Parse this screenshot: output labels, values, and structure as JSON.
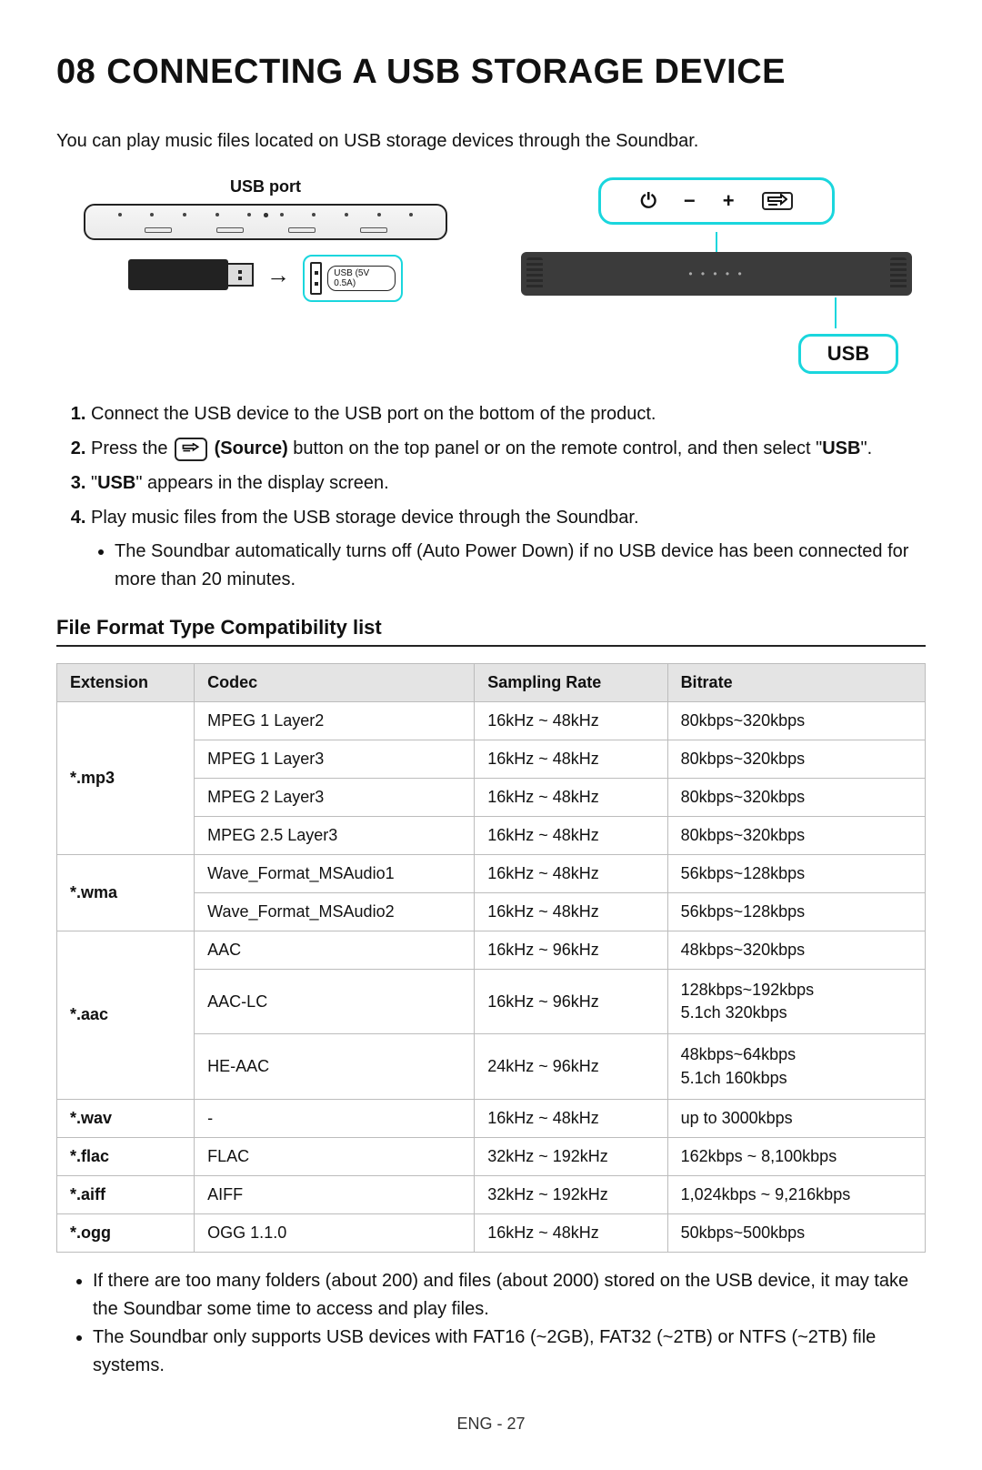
{
  "title": {
    "num": "08",
    "text": "CONNECTING A USB STORAGE DEVICE"
  },
  "intro": "You can play music files located on USB storage devices through the Soundbar.",
  "diagram": {
    "usb_port_label": "USB port",
    "usb_port_pill": "USB (5V 0.5A)",
    "display_text": "USB",
    "panel_power": "⏻",
    "panel_minus": "−",
    "panel_plus": "+",
    "panel_source": "↲⟶"
  },
  "steps": {
    "s1": "Connect the USB device to the USB port on the bottom of the product.",
    "s2_a": "Press the ",
    "s2_source": "(Source)",
    "s2_b": " button on the top panel or on the remote control, and then select \"",
    "s2_usb": "USB",
    "s2_c": "\".",
    "s3_a": "\"",
    "s3_usb": "USB",
    "s3_b": "\" appears in the display screen.",
    "s4": "Play music files from the USB storage device through the Soundbar.",
    "sub1": "The Soundbar automatically turns off (Auto Power Down) if no USB device has been connected for more than 20 minutes."
  },
  "section_heading": "File Format Type Compatibility list",
  "table": {
    "headers": {
      "ext": "Extension",
      "codec": "Codec",
      "rate": "Sampling Rate",
      "bitrate": "Bitrate"
    },
    "rows": [
      {
        "ext": "*.mp3",
        "codec": "MPEG 1 Layer2",
        "rate": "16kHz ~ 48kHz",
        "bitrate": "80kbps~320kbps",
        "rowspan": 4
      },
      {
        "codec": "MPEG 1 Layer3",
        "rate": "16kHz ~ 48kHz",
        "bitrate": "80kbps~320kbps"
      },
      {
        "codec": "MPEG 2 Layer3",
        "rate": "16kHz ~ 48kHz",
        "bitrate": "80kbps~320kbps"
      },
      {
        "codec": "MPEG 2.5 Layer3",
        "rate": "16kHz ~ 48kHz",
        "bitrate": "80kbps~320kbps"
      },
      {
        "ext": "*.wma",
        "codec": "Wave_Format_MSAudio1",
        "rate": "16kHz ~ 48kHz",
        "bitrate": "56kbps~128kbps",
        "rowspan": 2
      },
      {
        "codec": "Wave_Format_MSAudio2",
        "rate": "16kHz ~ 48kHz",
        "bitrate": "56kbps~128kbps"
      },
      {
        "ext": "*.aac",
        "codec": "AAC",
        "rate": "16kHz ~ 96kHz",
        "bitrate": "48kbps~320kbps",
        "rowspan": 3
      },
      {
        "codec": "AAC-LC",
        "rate": "16kHz ~ 96kHz",
        "bitrate": "128kbps~192kbps\n5.1ch 320kbps"
      },
      {
        "codec": "HE-AAC",
        "rate": "24kHz ~ 96kHz",
        "bitrate": "48kbps~64kbps\n5.1ch 160kbps"
      },
      {
        "ext": "*.wav",
        "codec": "-",
        "rate": "16kHz ~ 48kHz",
        "bitrate": "up to 3000kbps",
        "rowspan": 1
      },
      {
        "ext": "*.flac",
        "codec": "FLAC",
        "rate": "32kHz ~ 192kHz",
        "bitrate": "162kbps ~ 8,100kbps",
        "rowspan": 1
      },
      {
        "ext": "*.aiff",
        "codec": "AIFF",
        "rate": "32kHz ~ 192kHz",
        "bitrate": "1,024kbps ~ 9,216kbps",
        "rowspan": 1
      },
      {
        "ext": "*.ogg",
        "codec": "OGG 1.1.0",
        "rate": "16kHz ~ 48kHz",
        "bitrate": "50kbps~500kbps",
        "rowspan": 1
      }
    ]
  },
  "notes": {
    "n1": "If there are too many folders (about 200) and files (about 2000) stored on the USB device, it may take the Soundbar some time to access and play files.",
    "n2": "The Soundbar only supports USB devices with FAT16 (~2GB), FAT32 (~2TB) or NTFS (~2TB) file systems."
  },
  "footer": "ENG - 27"
}
